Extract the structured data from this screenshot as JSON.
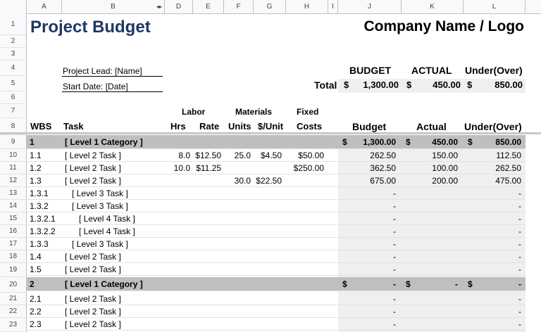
{
  "column_headers": [
    "A",
    "B",
    "D",
    "E",
    "F",
    "G",
    "H",
    "I",
    "J",
    "K",
    "L"
  ],
  "row_numbers": [
    "1",
    "2",
    "3",
    "4",
    "5",
    "6",
    "7",
    "8",
    "9",
    "10",
    "11",
    "12",
    "13",
    "14",
    "15",
    "16",
    "17",
    "18",
    "19",
    "20",
    "21",
    "22",
    "23"
  ],
  "sheet": {
    "title": "Project Budget",
    "company": "Company Name / Logo",
    "project_lead": "Project Lead: [Name]",
    "start_date": "Start Date: [Date]",
    "summary": {
      "budget_label": "BUDGET",
      "actual_label": "ACTUAL",
      "under_label": "Under(Over)",
      "total_label": "Total",
      "currency": "$",
      "budget": "1,300.00",
      "actual": "450.00",
      "under": "850.00"
    },
    "headers": {
      "labor": "Labor",
      "materials": "Materials",
      "fixed": "Fixed",
      "wbs": "WBS",
      "task": "Task",
      "hrs": "Hrs",
      "rate": "Rate",
      "units": "Units",
      "per_unit": "$/Unit",
      "costs": "Costs",
      "budget": "Budget",
      "actual": "Actual",
      "under": "Under(Over)"
    },
    "rows": [
      {
        "wbs": "1",
        "task": "[ Level 1 Category ]",
        "level": 1,
        "hrs": "",
        "rate": "",
        "units": "",
        "per_unit": "",
        "fixed": "",
        "budget": "1,300.00",
        "actual": "450.00",
        "under": "850.00"
      },
      {
        "wbs": "1.1",
        "task": "[ Level 2 Task ]",
        "level": 2,
        "hrs": "8.0",
        "rate": "$12.50",
        "units": "25.0",
        "per_unit": "$4.50",
        "fixed": "$50.00",
        "budget": "262.50",
        "actual": "150.00",
        "under": "112.50"
      },
      {
        "wbs": "1.2",
        "task": "[ Level 2 Task ]",
        "level": 2,
        "hrs": "10.0",
        "rate": "$11.25",
        "units": "",
        "per_unit": "",
        "fixed": "$250.00",
        "budget": "362.50",
        "actual": "100.00",
        "under": "262.50"
      },
      {
        "wbs": "1.3",
        "task": "[ Level 2 Task ]",
        "level": 2,
        "hrs": "",
        "rate": "",
        "units": "30.0",
        "per_unit": "$22.50",
        "fixed": "",
        "budget": "675.00",
        "actual": "200.00",
        "under": "475.00"
      },
      {
        "wbs": "1.3.1",
        "task": "[ Level 3 Task ]",
        "level": 3,
        "hrs": "",
        "rate": "",
        "units": "",
        "per_unit": "",
        "fixed": "",
        "budget": "-",
        "actual": "",
        "under": "-"
      },
      {
        "wbs": "1.3.2",
        "task": "[ Level 3 Task ]",
        "level": 3,
        "hrs": "",
        "rate": "",
        "units": "",
        "per_unit": "",
        "fixed": "",
        "budget": "-",
        "actual": "",
        "under": "-"
      },
      {
        "wbs": "1.3.2.1",
        "task": "[ Level 4 Task ]",
        "level": 4,
        "hrs": "",
        "rate": "",
        "units": "",
        "per_unit": "",
        "fixed": "",
        "budget": "-",
        "actual": "",
        "under": "-"
      },
      {
        "wbs": "1.3.2.2",
        "task": "[ Level 4 Task ]",
        "level": 4,
        "hrs": "",
        "rate": "",
        "units": "",
        "per_unit": "",
        "fixed": "",
        "budget": "-",
        "actual": "",
        "under": "-"
      },
      {
        "wbs": "1.3.3",
        "task": "[ Level 3 Task ]",
        "level": 3,
        "hrs": "",
        "rate": "",
        "units": "",
        "per_unit": "",
        "fixed": "",
        "budget": "-",
        "actual": "",
        "under": "-"
      },
      {
        "wbs": "1.4",
        "task": "[ Level 2 Task ]",
        "level": 2,
        "hrs": "",
        "rate": "",
        "units": "",
        "per_unit": "",
        "fixed": "",
        "budget": "-",
        "actual": "",
        "under": "-"
      },
      {
        "wbs": "1.5",
        "task": "[ Level 2 Task ]",
        "level": 2,
        "hrs": "",
        "rate": "",
        "units": "",
        "per_unit": "",
        "fixed": "",
        "budget": "-",
        "actual": "",
        "under": "-"
      },
      {
        "wbs": "2",
        "task": "[ Level 1 Category ]",
        "level": 1,
        "hrs": "",
        "rate": "",
        "units": "",
        "per_unit": "",
        "fixed": "",
        "budget": "-",
        "actual": "-",
        "under": "-"
      },
      {
        "wbs": "2.1",
        "task": "[ Level 2 Task ]",
        "level": 2,
        "hrs": "",
        "rate": "",
        "units": "",
        "per_unit": "",
        "fixed": "",
        "budget": "-",
        "actual": "",
        "under": "-"
      },
      {
        "wbs": "2.2",
        "task": "[ Level 2 Task ]",
        "level": 2,
        "hrs": "",
        "rate": "",
        "units": "",
        "per_unit": "",
        "fixed": "",
        "budget": "-",
        "actual": "",
        "under": "-"
      },
      {
        "wbs": "2.3",
        "task": "[ Level 2 Task ]",
        "level": 2,
        "hrs": "",
        "rate": "",
        "units": "",
        "per_unit": "",
        "fixed": "",
        "budget": "-",
        "actual": "",
        "under": "-"
      }
    ]
  }
}
